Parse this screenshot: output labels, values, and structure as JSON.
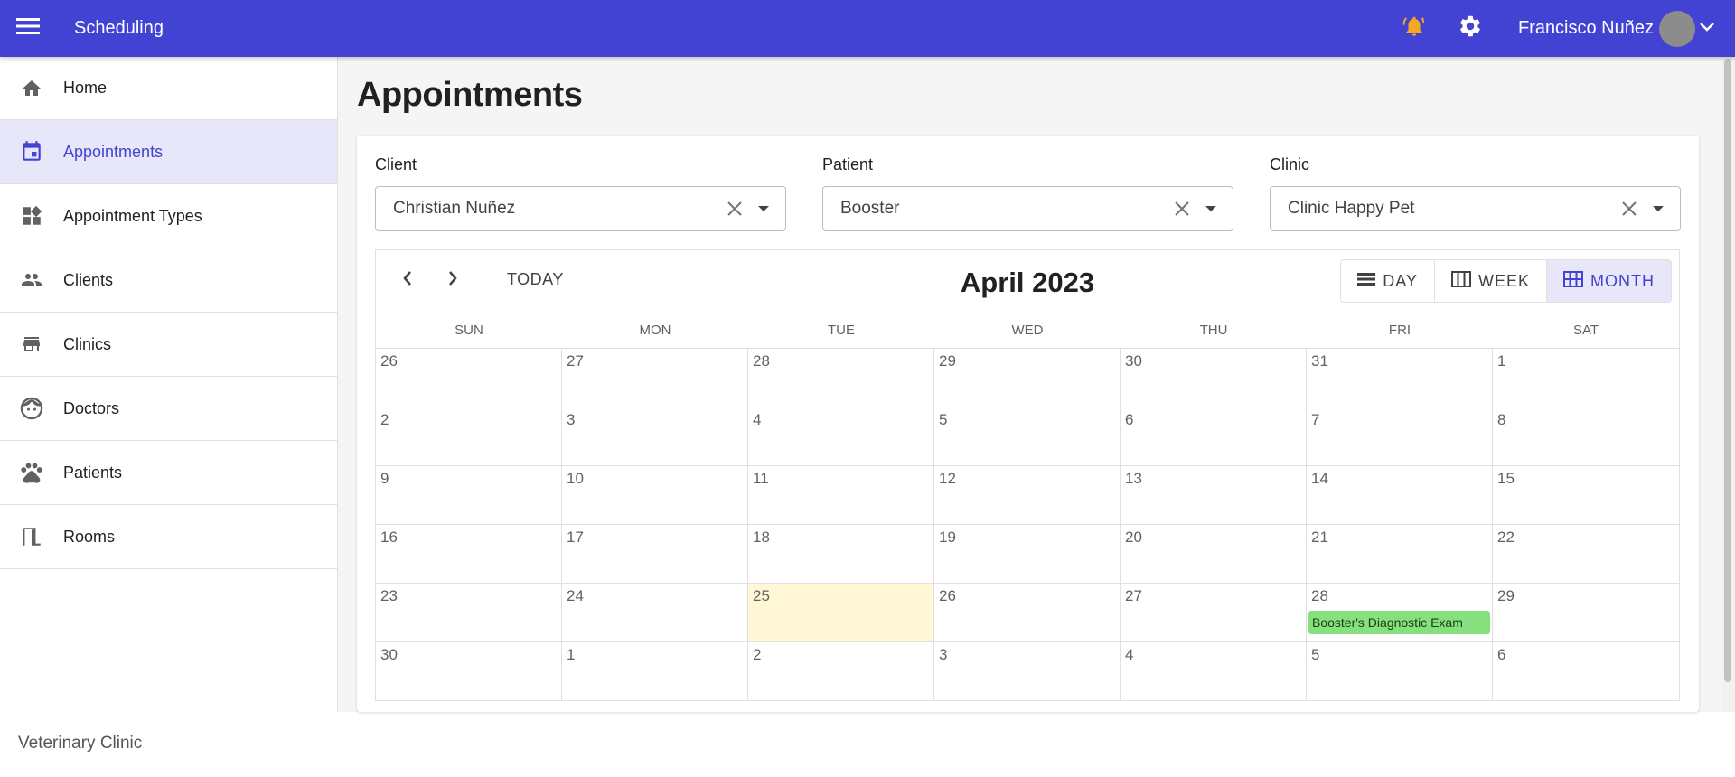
{
  "header": {
    "app_title": "Scheduling",
    "user_name": "Francisco Nuñez",
    "bell_color": "#f5a623",
    "brand_color": "#4343d3"
  },
  "sidebar": {
    "items": [
      {
        "label": "Home",
        "icon": "home-icon"
      },
      {
        "label": "Appointments",
        "icon": "calendar-icon",
        "active": true
      },
      {
        "label": "Appointment Types",
        "icon": "dashboard-icon"
      },
      {
        "label": "Clients",
        "icon": "people-icon"
      },
      {
        "label": "Clinics",
        "icon": "store-icon"
      },
      {
        "label": "Doctors",
        "icon": "face-icon"
      },
      {
        "label": "Patients",
        "icon": "paw-icon"
      },
      {
        "label": "Rooms",
        "icon": "door-icon"
      }
    ]
  },
  "footer": {
    "text": "Veterinary Clinic"
  },
  "main": {
    "title": "Appointments",
    "filters": {
      "client": {
        "label": "Client",
        "value": "Christian Nuñez"
      },
      "patient": {
        "label": "Patient",
        "value": "Booster"
      },
      "clinic": {
        "label": "Clinic",
        "value": "Clinic Happy Pet"
      }
    }
  },
  "calendar": {
    "today_label": "TODAY",
    "month_title": "April 2023",
    "views": {
      "day": "DAY",
      "week": "WEEK",
      "month": "MONTH",
      "active": "month"
    },
    "weekdays": [
      "SUN",
      "MON",
      "TUE",
      "WED",
      "THU",
      "FRI",
      "SAT"
    ],
    "days": [
      "26",
      "27",
      "28",
      "29",
      "30",
      "31",
      "1",
      "2",
      "3",
      "4",
      "5",
      "6",
      "7",
      "8",
      "9",
      "10",
      "11",
      "12",
      "13",
      "14",
      "15",
      "16",
      "17",
      "18",
      "19",
      "20",
      "21",
      "22",
      "23",
      "24",
      "25",
      "26",
      "27",
      "28",
      "29",
      "30",
      "1",
      "2",
      "3",
      "4",
      "5",
      "6"
    ],
    "today_cell_index": 30,
    "events": [
      {
        "cell_index": 33,
        "title": "Booster's Diagnostic Exam",
        "color": "#86e07e"
      }
    ]
  }
}
